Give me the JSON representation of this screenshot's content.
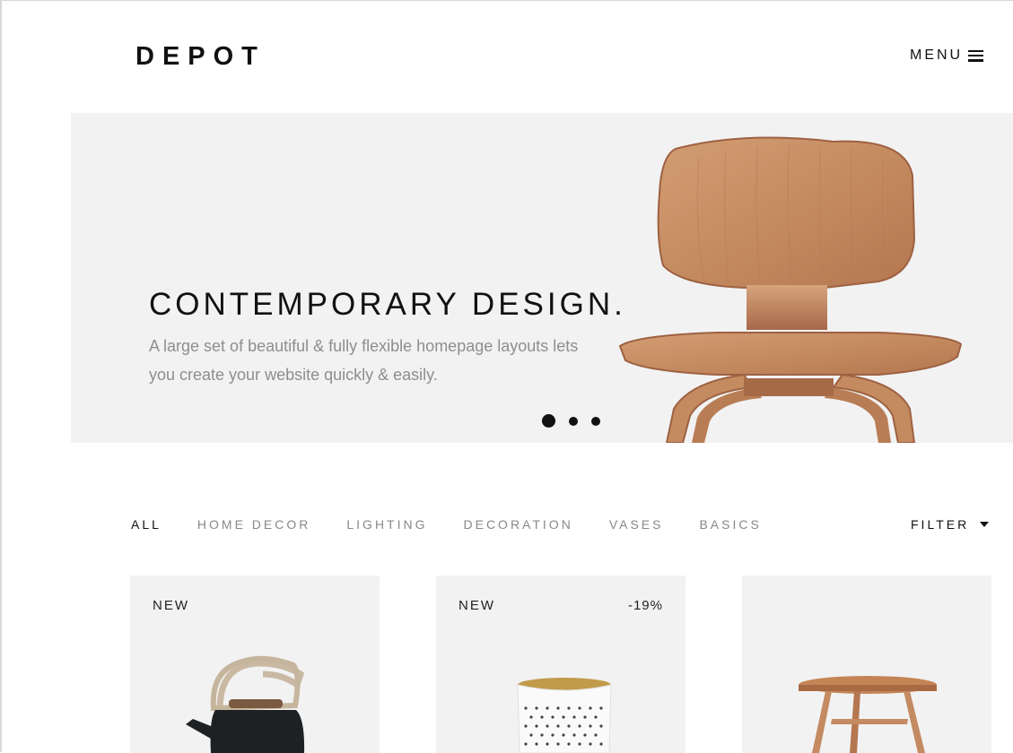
{
  "header": {
    "logo": "DEPOT",
    "menu_label": "MENU"
  },
  "hero": {
    "title": "CONTEMPORARY DESIGN.",
    "subtitle": "A large set of beautiful & fully flexible homepage layouts lets you create your website quickly & easily.",
    "slides": {
      "active": 1,
      "total": 3
    }
  },
  "filters": {
    "items": [
      "ALL",
      "HOME DECOR",
      "LIGHTING",
      "DECORATION",
      "VASES",
      "BASICS"
    ],
    "active": "ALL",
    "dropdown_label": "FILTER"
  },
  "products": [
    {
      "badge": "NEW",
      "discount": "",
      "image": "black kettle"
    },
    {
      "badge": "NEW",
      "discount": "-19%",
      "image": "perforated vase"
    },
    {
      "badge": "",
      "discount": "",
      "image": "wooden side table"
    }
  ],
  "colors": {
    "text": "#111111",
    "muted": "#8e8e8e",
    "panel": "#f2f2f2",
    "wood": "#c48a61"
  }
}
